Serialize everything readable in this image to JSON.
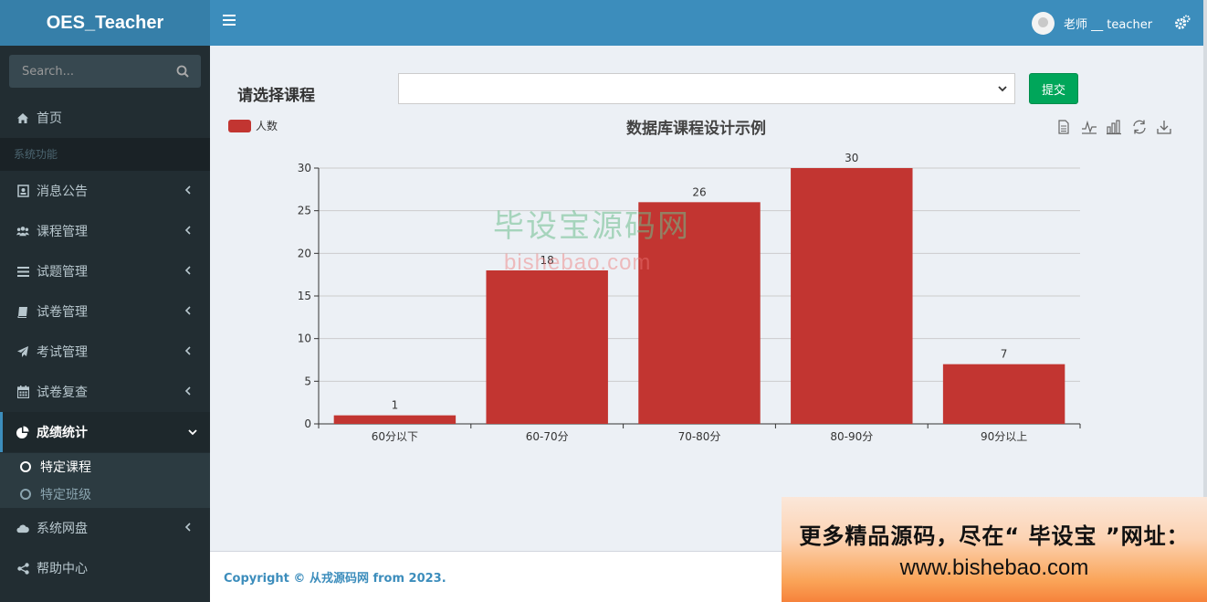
{
  "app": {
    "title": "OES_Teacher"
  },
  "header": {
    "menu_toggle": "bars-icon",
    "user_name": "老师 __ teacher",
    "settings_icon": "gears-icon"
  },
  "sidebar": {
    "search_placeholder": "Search...",
    "home": "首页",
    "section_header": "系统功能",
    "items": [
      {
        "label": "消息公告",
        "icon": "address-card-icon"
      },
      {
        "label": "课程管理",
        "icon": "users-icon"
      },
      {
        "label": "试题管理",
        "icon": "list-icon"
      },
      {
        "label": "试卷管理",
        "icon": "book-icon"
      },
      {
        "label": "考试管理",
        "icon": "paper-plane-icon"
      },
      {
        "label": "试卷复查",
        "icon": "calendar-icon"
      },
      {
        "label": "成绩统计",
        "icon": "pie-chart-icon"
      },
      {
        "label": "系统网盘",
        "icon": "cloud-icon"
      },
      {
        "label": "帮助中心",
        "icon": "share-alt-icon"
      }
    ],
    "submenu": [
      "特定课程",
      "特定班级"
    ]
  },
  "main": {
    "course_label": "请选择课程",
    "course_select_value": "",
    "submit_label": "提交"
  },
  "watermark": {
    "line1": "毕设宝源码网",
    "line2": "bishebao.com"
  },
  "footer": {
    "copyright": "Copyright © 从戎源码网 from 2023."
  },
  "ad": {
    "line1": "更多精品源码，尽在“ 毕设宝 ”网址：",
    "line2": "www.bishebao.com"
  },
  "chart_data": {
    "type": "bar",
    "title": "数据库课程设计示例",
    "categories": [
      "60分以下",
      "60-70分",
      "70-80分",
      "80-90分",
      "90分以上"
    ],
    "series": [
      {
        "name": "人数",
        "values": [
          1,
          18,
          26,
          30,
          7
        ],
        "color": "#c23531"
      }
    ],
    "ylim": [
      0,
      30
    ],
    "yticks": [
      0,
      5,
      10,
      15,
      20,
      25,
      30
    ],
    "xlabel": "",
    "ylabel": "",
    "grid": true,
    "legend": "top-left"
  }
}
